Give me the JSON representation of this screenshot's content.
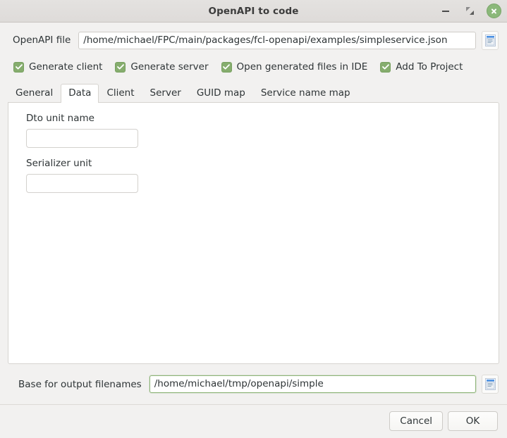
{
  "window": {
    "title": "OpenAPI to code",
    "controls": {
      "minimize": "minimize",
      "restore": "restore",
      "close": "close"
    }
  },
  "file_row": {
    "label": "OpenAPI file",
    "value": "/home/michael/FPC/main/packages/fcl-openapi/examples/simpleservice.json",
    "placeholder": "",
    "browse_icon": "file-document-icon"
  },
  "options": [
    {
      "label": "Generate client",
      "checked": true
    },
    {
      "label": "Generate server",
      "checked": true
    },
    {
      "label": "Open generated files in IDE",
      "checked": true
    },
    {
      "label": "Add To Project",
      "checked": true
    }
  ],
  "tabs": [
    {
      "label": "General",
      "active": false
    },
    {
      "label": "Data",
      "active": true
    },
    {
      "label": "Client",
      "active": false
    },
    {
      "label": "Server",
      "active": false
    },
    {
      "label": "GUID map",
      "active": false
    },
    {
      "label": "Service name map",
      "active": false
    }
  ],
  "data_tab": {
    "fields": [
      {
        "label": "Dto unit name",
        "value": "",
        "placeholder": ""
      },
      {
        "label": "Serializer unit",
        "value": "",
        "placeholder": ""
      }
    ]
  },
  "base_row": {
    "label": "Base for output filenames",
    "value": "/home/michael/tmp/openapi/simple",
    "placeholder": "",
    "focused": true,
    "browse_icon": "file-document-icon"
  },
  "actions": {
    "cancel_label": "Cancel",
    "ok_label": "OK"
  },
  "colors": {
    "checkbox_green": "#86ad6e",
    "close_green": "#8bb87a",
    "focus_green": "#8fb57a",
    "window_bg": "#f2f1f0",
    "panel_bg": "#ffffff"
  }
}
